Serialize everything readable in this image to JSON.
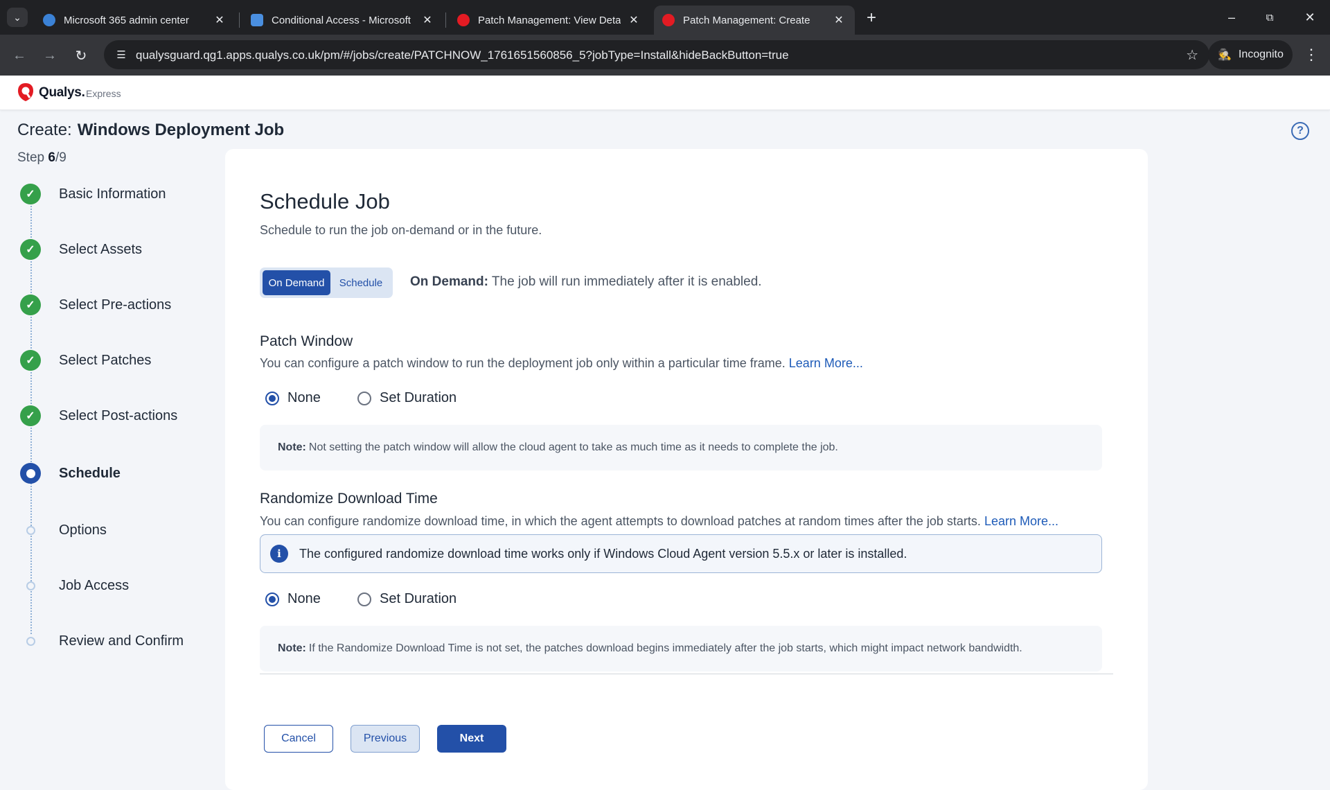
{
  "browser": {
    "tabs": [
      {
        "title": "Microsoft 365 admin center",
        "active": false
      },
      {
        "title": "Conditional Access - Microsoft E",
        "active": false
      },
      {
        "title": "Patch Management: View Details",
        "active": false
      },
      {
        "title": "Patch Management: Create",
        "active": true
      }
    ],
    "url": "qualysguard.qg1.apps.qualys.co.uk/pm/#/jobs/create/PATCHNOW_1761651560856_5?jobType=Install&hideBackButton=true",
    "incognito_label": "Incognito"
  },
  "app": {
    "brand": "Qualys.",
    "product": "Express",
    "brand_color": "#e31b23"
  },
  "page": {
    "title_prefix": "Create:",
    "title": "Windows Deployment Job",
    "step_prefix": "Step",
    "step_current": "6",
    "step_total": "/9"
  },
  "steps": [
    {
      "label": "Basic Information",
      "status": "done"
    },
    {
      "label": "Select Assets",
      "status": "done"
    },
    {
      "label": "Select Pre-actions",
      "status": "done"
    },
    {
      "label": "Select Patches",
      "status": "done"
    },
    {
      "label": "Select Post-actions",
      "status": "done"
    },
    {
      "label": "Schedule",
      "status": "current"
    },
    {
      "label": "Options",
      "status": "todo"
    },
    {
      "label": "Job Access",
      "status": "todo"
    },
    {
      "label": "Review and Confirm",
      "status": "todo"
    }
  ],
  "schedule": {
    "heading": "Schedule Job",
    "description": "Schedule to run the job on-demand or in the future.",
    "toggle_on_demand": "On Demand",
    "toggle_schedule": "Schedule",
    "selected": "On Demand",
    "on_demand_label": "On Demand:",
    "on_demand_text": "The job will run immediately after it is enabled."
  },
  "patch_window": {
    "heading": "Patch Window",
    "description": "You can configure a patch window to run the deployment job only within a particular time frame.",
    "learn_more": "Learn More...",
    "option_none": "None",
    "option_set": "Set Duration",
    "selected": "None",
    "note_label": "Note:",
    "note_text": "Not setting the patch window will allow the cloud agent to take as much time as it needs to complete the job."
  },
  "randomize": {
    "heading": "Randomize Download Time",
    "description": "You can configure randomize download time, in which the agent attempts to download patches at random times after the job starts.",
    "learn_more": "Learn More...",
    "info_text": "The configured randomize download time works only if Windows Cloud Agent version 5.5.x or later is installed.",
    "option_none": "None",
    "option_set": "Set Duration",
    "selected": "None",
    "note_label": "Note:",
    "note_text": "If the Randomize Download Time is not set, the patches download begins immediately after the job starts, which might impact network bandwidth."
  },
  "footer": {
    "cancel": "Cancel",
    "previous": "Previous",
    "next": "Next"
  }
}
